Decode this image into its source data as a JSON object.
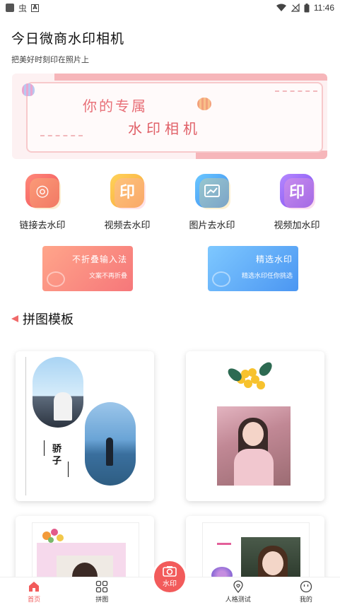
{
  "status_bar": {
    "time": "11:46",
    "left_icons": [
      "app-square-icon",
      "bug-icon",
      "a-box-icon"
    ],
    "right_icons": [
      "wifi-icon",
      "signal-icon",
      "battery-icon"
    ]
  },
  "header": {
    "title": "今日微商水印相机",
    "subtitle": "把美好时刻印在照片上"
  },
  "banner": {
    "line1": "你的专属",
    "line2": "水印相机"
  },
  "features": [
    {
      "label": "链接去水印",
      "icon": "link-watermark-icon",
      "glyph": "◎"
    },
    {
      "label": "视频去水印",
      "icon": "video-watermark-icon",
      "glyph": "印"
    },
    {
      "label": "图片去水印",
      "icon": "image-watermark-icon",
      "glyph": "▦"
    },
    {
      "label": "视频加水印",
      "icon": "video-add-watermark-icon",
      "glyph": "印"
    }
  ],
  "promos": [
    {
      "title": "不折叠输入法",
      "subtitle": "文案不再折叠"
    },
    {
      "title": "精选水印",
      "subtitle": "精选水印任你挑选"
    }
  ],
  "section": {
    "title": "拼图模板"
  },
  "template_cards": {
    "card1_text": "骄子"
  },
  "bottom_nav": {
    "items": [
      {
        "label": "首页",
        "icon": "home-icon",
        "active": true
      },
      {
        "label": "拼图",
        "icon": "grid-icon",
        "active": false
      },
      {
        "label": "水印",
        "icon": "camera-icon",
        "active": false
      },
      {
        "label": "人格测试",
        "icon": "location-heart-icon",
        "active": false
      },
      {
        "label": "我的",
        "icon": "smiley-icon",
        "active": false
      }
    ]
  },
  "colors": {
    "accent": "#f25b5b",
    "banner_text": "#e87078"
  }
}
